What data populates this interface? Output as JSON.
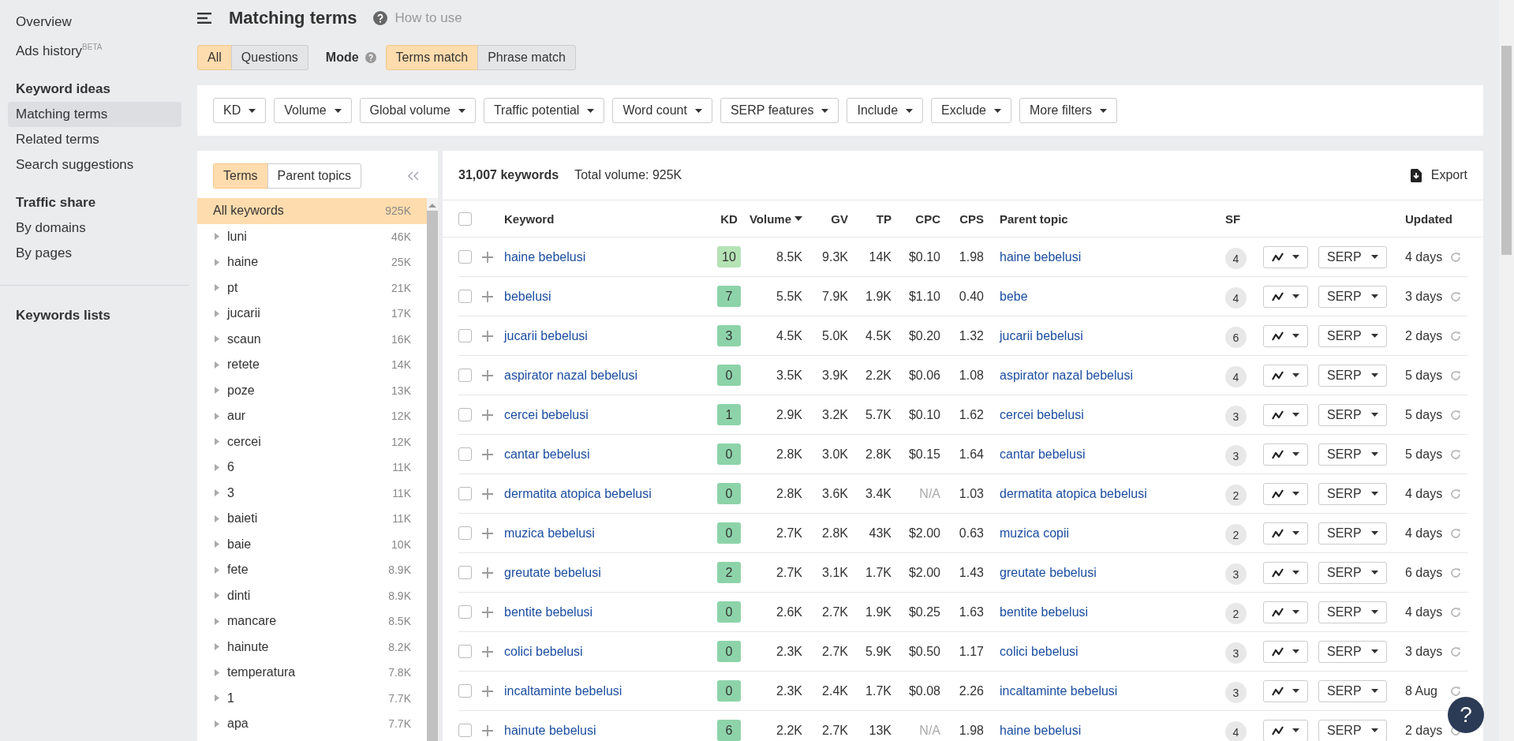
{
  "sidebar": {
    "links": [
      {
        "label": "Overview",
        "selected": false
      },
      {
        "label": "Ads history$^{BETA}$",
        "selected": false
      }
    ],
    "sections": [
      {
        "heading": "Keyword ideas",
        "items": [
          {
            "label": "Matching terms",
            "selected": true
          },
          {
            "label": "Related terms",
            "selected": false
          },
          {
            "label": "Search suggestions",
            "selected": false
          }
        ]
      },
      {
        "heading": "Traffic share",
        "items": [
          {
            "label": "By domains",
            "selected": false
          },
          {
            "label": "By pages",
            "selected": false
          }
        ]
      }
    ],
    "lists_heading": "Keywords lists"
  },
  "header": {
    "title": "Matching terms",
    "help_link": "How to use"
  },
  "scope_tabs": [
    {
      "label": "All",
      "selected": true
    },
    {
      "label": "Questions",
      "selected": false
    }
  ],
  "mode": {
    "label": "Mode",
    "options": [
      {
        "label": "Terms match",
        "selected": true
      },
      {
        "label": "Phrase match",
        "selected": false
      }
    ]
  },
  "filters": [
    "KD",
    "Volume",
    "Global volume",
    "Traffic potential",
    "Word count",
    "SERP features",
    "Include",
    "Exclude",
    "More filters"
  ],
  "terms_panel": {
    "tabs": [
      {
        "label": "Terms",
        "selected": true
      },
      {
        "label": "Parent topics",
        "selected": false
      }
    ],
    "items": [
      {
        "label": "All keywords",
        "count": "925K",
        "selected": true,
        "kind": "all"
      },
      {
        "label": "luni",
        "count": "46K",
        "selected": false,
        "kind": "term"
      },
      {
        "label": "haine",
        "count": "25K",
        "selected": false,
        "kind": "term"
      },
      {
        "label": "pt",
        "count": "21K",
        "selected": false,
        "kind": "term"
      },
      {
        "label": "jucarii",
        "count": "17K",
        "selected": false,
        "kind": "term"
      },
      {
        "label": "scaun",
        "count": "16K",
        "selected": false,
        "kind": "term"
      },
      {
        "label": "retete",
        "count": "14K",
        "selected": false,
        "kind": "term"
      },
      {
        "label": "poze",
        "count": "13K",
        "selected": false,
        "kind": "term"
      },
      {
        "label": "aur",
        "count": "12K",
        "selected": false,
        "kind": "term"
      },
      {
        "label": "cercei",
        "count": "12K",
        "selected": false,
        "kind": "term"
      },
      {
        "label": "6",
        "count": "11K",
        "selected": false,
        "kind": "term"
      },
      {
        "label": "3",
        "count": "11K",
        "selected": false,
        "kind": "term"
      },
      {
        "label": "baieti",
        "count": "11K",
        "selected": false,
        "kind": "term"
      },
      {
        "label": "baie",
        "count": "10K",
        "selected": false,
        "kind": "term"
      },
      {
        "label": "fete",
        "count": "8.9K",
        "selected": false,
        "kind": "term"
      },
      {
        "label": "dinti",
        "count": "8.9K",
        "selected": false,
        "kind": "term"
      },
      {
        "label": "mancare",
        "count": "8.5K",
        "selected": false,
        "kind": "term"
      },
      {
        "label": "hainute",
        "count": "8.2K",
        "selected": false,
        "kind": "term"
      },
      {
        "label": "temperatura",
        "count": "7.8K",
        "selected": false,
        "kind": "term"
      },
      {
        "label": "1",
        "count": "7.7K",
        "selected": false,
        "kind": "term"
      },
      {
        "label": "apa",
        "count": "7.7K",
        "selected": false,
        "kind": "term"
      }
    ]
  },
  "table": {
    "count": "31,007 keywords",
    "total": "Total volume: 925K",
    "export": "Export",
    "header_checked": false,
    "columns": [
      "Keyword",
      "KD",
      "Volume",
      "GV",
      "TP",
      "CPC",
      "CPS",
      "Parent topic",
      "SF",
      "Updated"
    ],
    "rows": [
      {
        "checked": false,
        "keyword": "haine bebelusi",
        "kd": "10",
        "color": "#b5e3b5",
        "volume": "8.5K",
        "gv": "9.3K",
        "tp": "14K",
        "cpc": "$0.10",
        "cpc_muted": false,
        "cps": "1.98",
        "parent": "haine bebelusi",
        "sf": "4",
        "serp": "SERP",
        "updated": "4 days"
      },
      {
        "checked": false,
        "keyword": "bebelusi",
        "kd": "7",
        "color": "#8dd3a9",
        "volume": "5.5K",
        "gv": "7.9K",
        "tp": "1.9K",
        "cpc": "$1.10",
        "cpc_muted": false,
        "cps": "0.40",
        "parent": "bebe",
        "sf": "4",
        "serp": "SERP",
        "updated": "3 days"
      },
      {
        "checked": false,
        "keyword": "jucarii bebelusi",
        "kd": "3",
        "color": "#8dd3a9",
        "volume": "4.5K",
        "gv": "5.0K",
        "tp": "4.5K",
        "cpc": "$0.20",
        "cpc_muted": false,
        "cps": "1.32",
        "parent": "jucarii bebelusi",
        "sf": "6",
        "serp": "SERP",
        "updated": "2 days"
      },
      {
        "checked": false,
        "keyword": "aspirator nazal bebelusi",
        "kd": "0",
        "color": "#8dd3a9",
        "volume": "3.5K",
        "gv": "3.9K",
        "tp": "2.2K",
        "cpc": "$0.06",
        "cpc_muted": false,
        "cps": "1.08",
        "parent": "aspirator nazal bebelusi",
        "sf": "4",
        "serp": "SERP",
        "updated": "5 days"
      },
      {
        "checked": false,
        "keyword": "cercei bebelusi",
        "kd": "1",
        "color": "#8dd3a9",
        "volume": "2.9K",
        "gv": "3.2K",
        "tp": "5.7K",
        "cpc": "$0.10",
        "cpc_muted": false,
        "cps": "1.62",
        "parent": "cercei bebelusi",
        "sf": "3",
        "serp": "SERP",
        "updated": "5 days"
      },
      {
        "checked": false,
        "keyword": "cantar bebelusi",
        "kd": "0",
        "color": "#8dd3a9",
        "volume": "2.8K",
        "gv": "3.0K",
        "tp": "2.8K",
        "cpc": "$0.15",
        "cpc_muted": false,
        "cps": "1.64",
        "parent": "cantar bebelusi",
        "sf": "3",
        "serp": "SERP",
        "updated": "5 days"
      },
      {
        "checked": false,
        "keyword": "dermatita atopica bebelusi",
        "kd": "0",
        "color": "#8dd3a9",
        "volume": "2.8K",
        "gv": "3.6K",
        "tp": "3.4K",
        "cpc": "N/A",
        "cpc_muted": true,
        "cps": "1.03",
        "parent": "dermatita atopica bebelusi",
        "sf": "2",
        "serp": "SERP",
        "updated": "4 days"
      },
      {
        "checked": false,
        "keyword": "muzica bebelusi",
        "kd": "0",
        "color": "#8dd3a9",
        "volume": "2.7K",
        "gv": "2.8K",
        "tp": "43K",
        "cpc": "$2.00",
        "cpc_muted": false,
        "cps": "0.63",
        "parent": "muzica copii",
        "sf": "2",
        "serp": "SERP",
        "updated": "4 days"
      },
      {
        "checked": false,
        "keyword": "greutate bebelusi",
        "kd": "2",
        "color": "#8dd3a9",
        "volume": "2.7K",
        "gv": "3.1K",
        "tp": "1.7K",
        "cpc": "$2.00",
        "cpc_muted": false,
        "cps": "1.43",
        "parent": "greutate bebelusi",
        "sf": "3",
        "serp": "SERP",
        "updated": "6 days"
      },
      {
        "checked": false,
        "keyword": "bentite bebelusi",
        "kd": "0",
        "color": "#8dd3a9",
        "volume": "2.6K",
        "gv": "2.7K",
        "tp": "1.9K",
        "cpc": "$0.25",
        "cpc_muted": false,
        "cps": "1.63",
        "parent": "bentite bebelusi",
        "sf": "2",
        "serp": "SERP",
        "updated": "4 days"
      },
      {
        "checked": false,
        "keyword": "colici bebelusi",
        "kd": "0",
        "color": "#8dd3a9",
        "volume": "2.3K",
        "gv": "2.7K",
        "tp": "5.9K",
        "cpc": "$0.50",
        "cpc_muted": false,
        "cps": "1.17",
        "parent": "colici bebelusi",
        "sf": "3",
        "serp": "SERP",
        "updated": "3 days"
      },
      {
        "checked": false,
        "keyword": "incaltaminte bebelusi",
        "kd": "0",
        "color": "#8dd3a9",
        "volume": "2.3K",
        "gv": "2.4K",
        "tp": "1.7K",
        "cpc": "$0.08",
        "cpc_muted": false,
        "cps": "2.26",
        "parent": "incaltaminte bebelusi",
        "sf": "3",
        "serp": "SERP",
        "updated": "8 Aug"
      },
      {
        "checked": false,
        "keyword": "hainute bebelusi",
        "kd": "6",
        "color": "#8dd3a9",
        "volume": "2.2K",
        "gv": "2.7K",
        "tp": "13K",
        "cpc": "N/A",
        "cpc_muted": true,
        "cps": "1.98",
        "parent": "haine bebelusi",
        "sf": "4",
        "serp": "SERP",
        "updated": "2 days"
      }
    ]
  },
  "help_button": "?"
}
